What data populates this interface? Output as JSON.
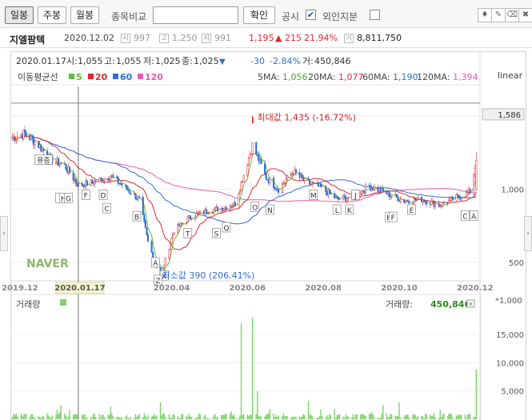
{
  "toolbar": {
    "tabs": [
      "일봉",
      "주봉",
      "월봉"
    ],
    "compare_label": "종목비교",
    "compare_placeholder": "",
    "confirm_label": "확인",
    "gongsi_label": "공시",
    "gongsi_checked": true,
    "foreign_label": "외인지분",
    "foreign_checked": false,
    "tools": [
      "marker-icon",
      "pen-icon",
      "eraser-icon",
      "trash-icon"
    ]
  },
  "stock": {
    "name": "지엘팜텍",
    "date": "2020.12.02",
    "open_icon": "시",
    "open": "997",
    "high_icon": "고",
    "high": "1,250",
    "low_icon": "저",
    "low": "991",
    "close": "1,195",
    "change": "▲ 215",
    "change_pct": "21.94%",
    "vol_icon": "거",
    "volume": "8,811,750"
  },
  "legend_ohlc": {
    "date": "2020.01.17",
    "open_label": "시:",
    "open": "1,055",
    "high_label": "고:",
    "high": "1,055",
    "low_label": "저:",
    "low": "1,025",
    "close_label": "종:",
    "close": "1,025",
    "arrow": "▼",
    "change": "-30",
    "change_pct": "-2.84%",
    "vol_label": "거:",
    "volume": "450,846"
  },
  "ma_legend": {
    "label": "이동평균선",
    "items": [
      {
        "period": "5",
        "color": "#5bbf3c"
      },
      {
        "period": "20",
        "color": "#e0282e"
      },
      {
        "period": "60",
        "color": "#2f6fd0"
      },
      {
        "period": "120",
        "color": "#e85bb0"
      }
    ],
    "values": [
      {
        "label": "5MA:",
        "value": "1,056",
        "color": "#4aa62e"
      },
      {
        "label": "20MA:",
        "value": "1,077",
        "color": "#e0282e"
      },
      {
        "label": "60MA:",
        "value": "1,190",
        "color": "#2f6fd0"
      },
      {
        "label": "120MA:",
        "value": "1,394",
        "color": "#e85bb0"
      }
    ],
    "scale": "linear"
  },
  "volume_legend": {
    "label": "거래량",
    "value_label": "거래량:",
    "value": "450,846",
    "unit": "*1,000"
  },
  "colors": {
    "up": "#e0282e",
    "down": "#2f6fd0",
    "volume": "#7ed36b",
    "crosshair": "#555555"
  },
  "chart_data": [
    {
      "type": "candlestick",
      "scale": "linear",
      "ylim": [
        380,
        1700
      ],
      "yticks": [
        500,
        1000,
        1500
      ],
      "ytick_labels": [
        "500",
        "1,000",
        "1,500"
      ],
      "xticks": [
        {
          "date": "2019-12-01",
          "label": "2019.12"
        },
        {
          "date": "2020-02-01",
          "label": "02"
        },
        {
          "date": "2020-04-01",
          "label": "2020.04"
        },
        {
          "date": "2020-06-01",
          "label": "2020.06"
        },
        {
          "date": "2020-08-01",
          "label": "2020.08"
        },
        {
          "date": "2020-10-01",
          "label": "2020.10"
        },
        {
          "date": "2020-12-01",
          "label": "2020.12"
        }
      ],
      "x_range": [
        "2019-11-24",
        "2020-12-05"
      ],
      "crosshair": {
        "date": "2020-01-17",
        "label": "2020.01.17"
      },
      "reference_line": {
        "value": 1586,
        "label": "1,586"
      },
      "max_annotation": {
        "date": "2020-06-05",
        "value": 1435,
        "text": "최대값 1,435 (-16.72%)"
      },
      "min_annotation": {
        "date": "2020-03-23",
        "value": 390,
        "text": "최소값 390 (206.41%)"
      },
      "close_series": [
        [
          "2019-11-25",
          1350
        ],
        [
          "2019-12-05",
          1380
        ],
        [
          "2019-12-16",
          1300
        ],
        [
          "2019-12-26",
          1200
        ],
        [
          "2020-01-06",
          1160
        ],
        [
          "2020-01-17",
          1025
        ],
        [
          "2020-01-30",
          1050
        ],
        [
          "2020-02-12",
          1090
        ],
        [
          "2020-02-25",
          1000
        ],
        [
          "2020-03-06",
          930
        ],
        [
          "2020-03-13",
          640
        ],
        [
          "2020-03-23",
          400
        ],
        [
          "2020-04-03",
          720
        ],
        [
          "2020-04-16",
          810
        ],
        [
          "2020-04-29",
          850
        ],
        [
          "2020-05-12",
          870
        ],
        [
          "2020-05-22",
          900
        ],
        [
          "2020-06-05",
          1300
        ],
        [
          "2020-06-16",
          1080
        ],
        [
          "2020-06-26",
          1000
        ],
        [
          "2020-07-08",
          1120
        ],
        [
          "2020-07-17",
          1050
        ],
        [
          "2020-07-30",
          1010
        ],
        [
          "2020-08-12",
          930
        ],
        [
          "2020-08-25",
          950
        ],
        [
          "2020-09-07",
          1020
        ],
        [
          "2020-09-21",
          970
        ],
        [
          "2020-10-05",
          920
        ],
        [
          "2020-10-19",
          930
        ],
        [
          "2020-11-02",
          890
        ],
        [
          "2020-11-16",
          940
        ],
        [
          "2020-11-27",
          980
        ],
        [
          "2020-12-02",
          1195
        ]
      ],
      "gongsi_markers": [
        {
          "label": "유증",
          "date": "2019-12-20",
          "value": 1200
        },
        {
          "label": "I",
          "date": "2020-01-02",
          "value": 940
        },
        {
          "label": "H",
          "date": "2020-01-05",
          "value": 940
        },
        {
          "label": "G",
          "date": "2020-01-09",
          "value": 940
        },
        {
          "label": "F",
          "date": "2020-01-23",
          "value": 960
        },
        {
          "label": "D",
          "date": "2020-02-06",
          "value": 960
        },
        {
          "label": "C",
          "date": "2020-02-09",
          "value": 870
        },
        {
          "label": "B",
          "date": "2020-03-04",
          "value": 815
        },
        {
          "label": "A",
          "date": "2020-03-19",
          "value": 500
        },
        {
          "label": "X",
          "date": "2020-03-26",
          "value": 410
        },
        {
          "label": "Z",
          "date": "2020-03-21",
          "value": 380
        },
        {
          "label": "T",
          "date": "2020-04-14",
          "value": 700
        },
        {
          "label": "S",
          "date": "2020-05-07",
          "value": 700
        },
        {
          "label": "Q",
          "date": "2020-05-15",
          "value": 740
        },
        {
          "label": "O",
          "date": "2020-06-07",
          "value": 880
        },
        {
          "label": "N",
          "date": "2020-06-19",
          "value": 860
        },
        {
          "label": "M",
          "date": "2020-07-24",
          "value": 960
        },
        {
          "label": "L",
          "date": "2020-08-12",
          "value": 860
        },
        {
          "label": "K",
          "date": "2020-08-22",
          "value": 860
        },
        {
          "label": "J",
          "date": "2020-08-27",
          "value": 960
        },
        {
          "label": "H",
          "date": "2020-09-23",
          "value": 810
        },
        {
          "label": "F",
          "date": "2020-09-26",
          "value": 810
        },
        {
          "label": "E",
          "date": "2020-10-11",
          "value": 860
        },
        {
          "label": "C",
          "date": "2020-11-23",
          "value": 820
        },
        {
          "label": "A",
          "date": "2020-11-30",
          "value": 820
        }
      ]
    },
    {
      "type": "bar",
      "name": "거래량",
      "unit": "*1,000",
      "ylim": [
        0,
        19000
      ],
      "yticks": [
        5000,
        10000,
        15000
      ],
      "ytick_labels": [
        "5,000",
        "10,000",
        "15,000"
      ],
      "spikes": [
        [
          "2020-03-23",
          3000
        ],
        [
          "2020-05-27",
          17000
        ],
        [
          "2020-06-05",
          18000
        ],
        [
          "2020-06-09",
          5000
        ],
        [
          "2020-07-20",
          3300
        ],
        [
          "2020-12-02",
          8811
        ]
      ]
    }
  ],
  "naver_logo": "NAVER"
}
